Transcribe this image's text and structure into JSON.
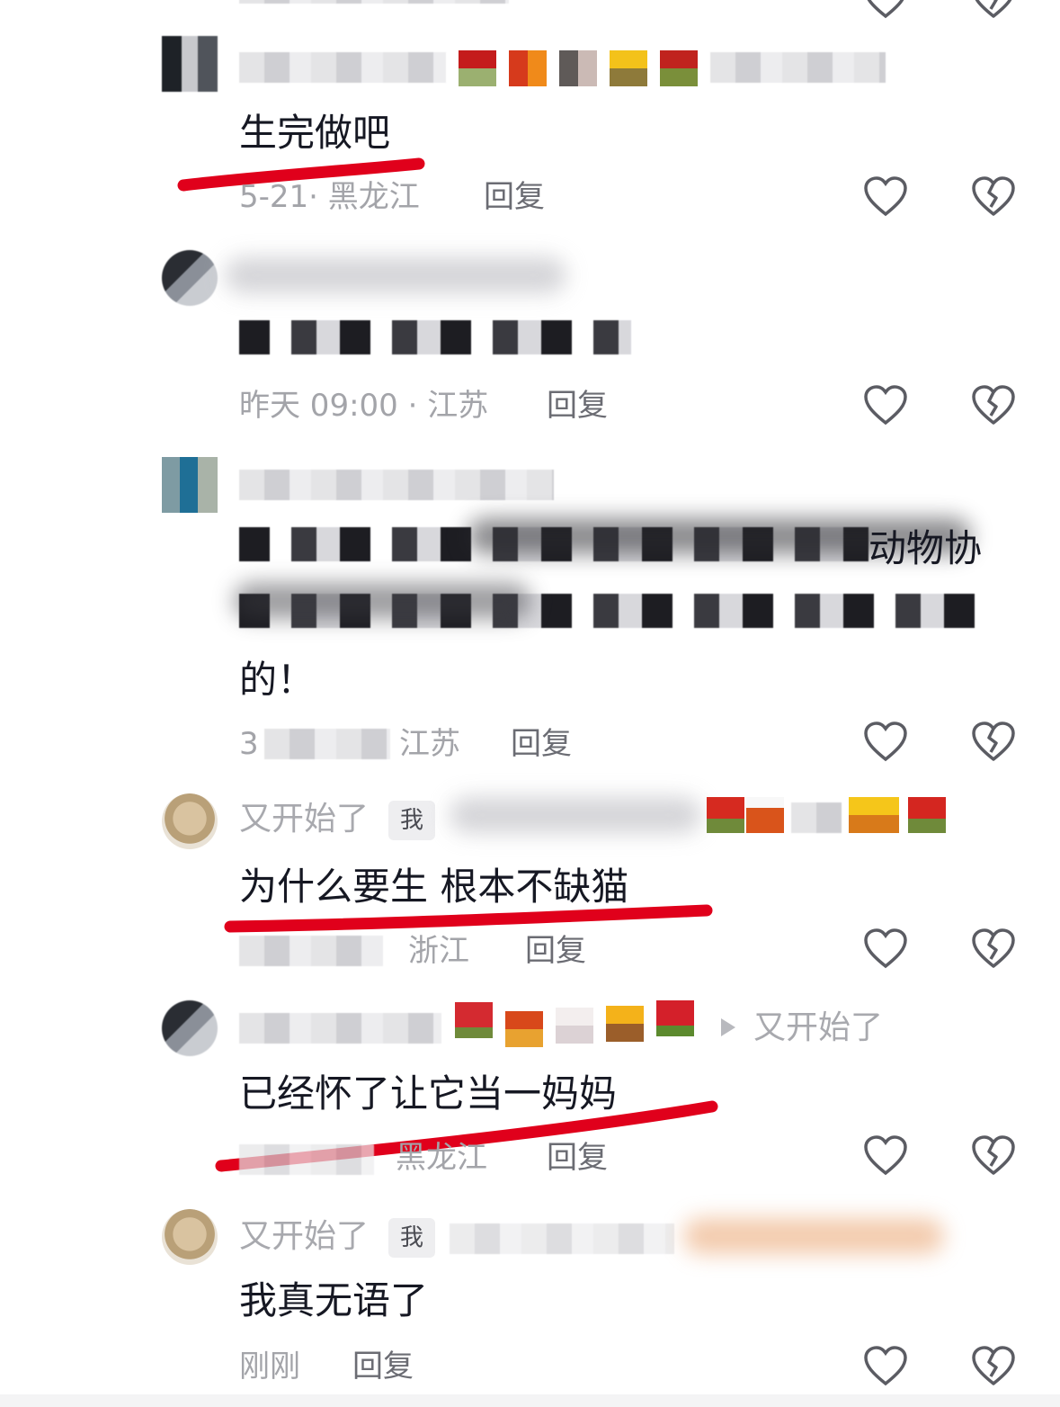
{
  "comments": [
    {
      "content": "生完做吧",
      "time_loc": "5-21· 黑龙江",
      "reply": "回复"
    },
    {
      "content_visible": "",
      "time_loc": "昨天 09:00 · 江苏",
      "reply": "回复"
    },
    {
      "content_tail": "动物协",
      "content_end": "的！",
      "time_loc": "3",
      "loc_tail": "江苏",
      "reply": "回复"
    },
    {
      "username": "又开始了",
      "badge": "我",
      "content": "为什么要生 根本不缺猫",
      "time_loc": "浙江",
      "reply": "回复"
    },
    {
      "reply_to": "又开始了",
      "content": "已经怀了让它当一妈妈",
      "time_loc": "黑龙江",
      "reply": "回复"
    },
    {
      "username": "又开始了",
      "badge": "我",
      "content": "我真无语了",
      "time_loc": "刚刚",
      "reply": "回复"
    }
  ],
  "colors": {
    "underline": "#e0001b",
    "meta": "#a3a4a9",
    "text": "#161823"
  },
  "icons": {
    "like": "heart-outline-icon",
    "dislike": "broken-heart-icon"
  }
}
